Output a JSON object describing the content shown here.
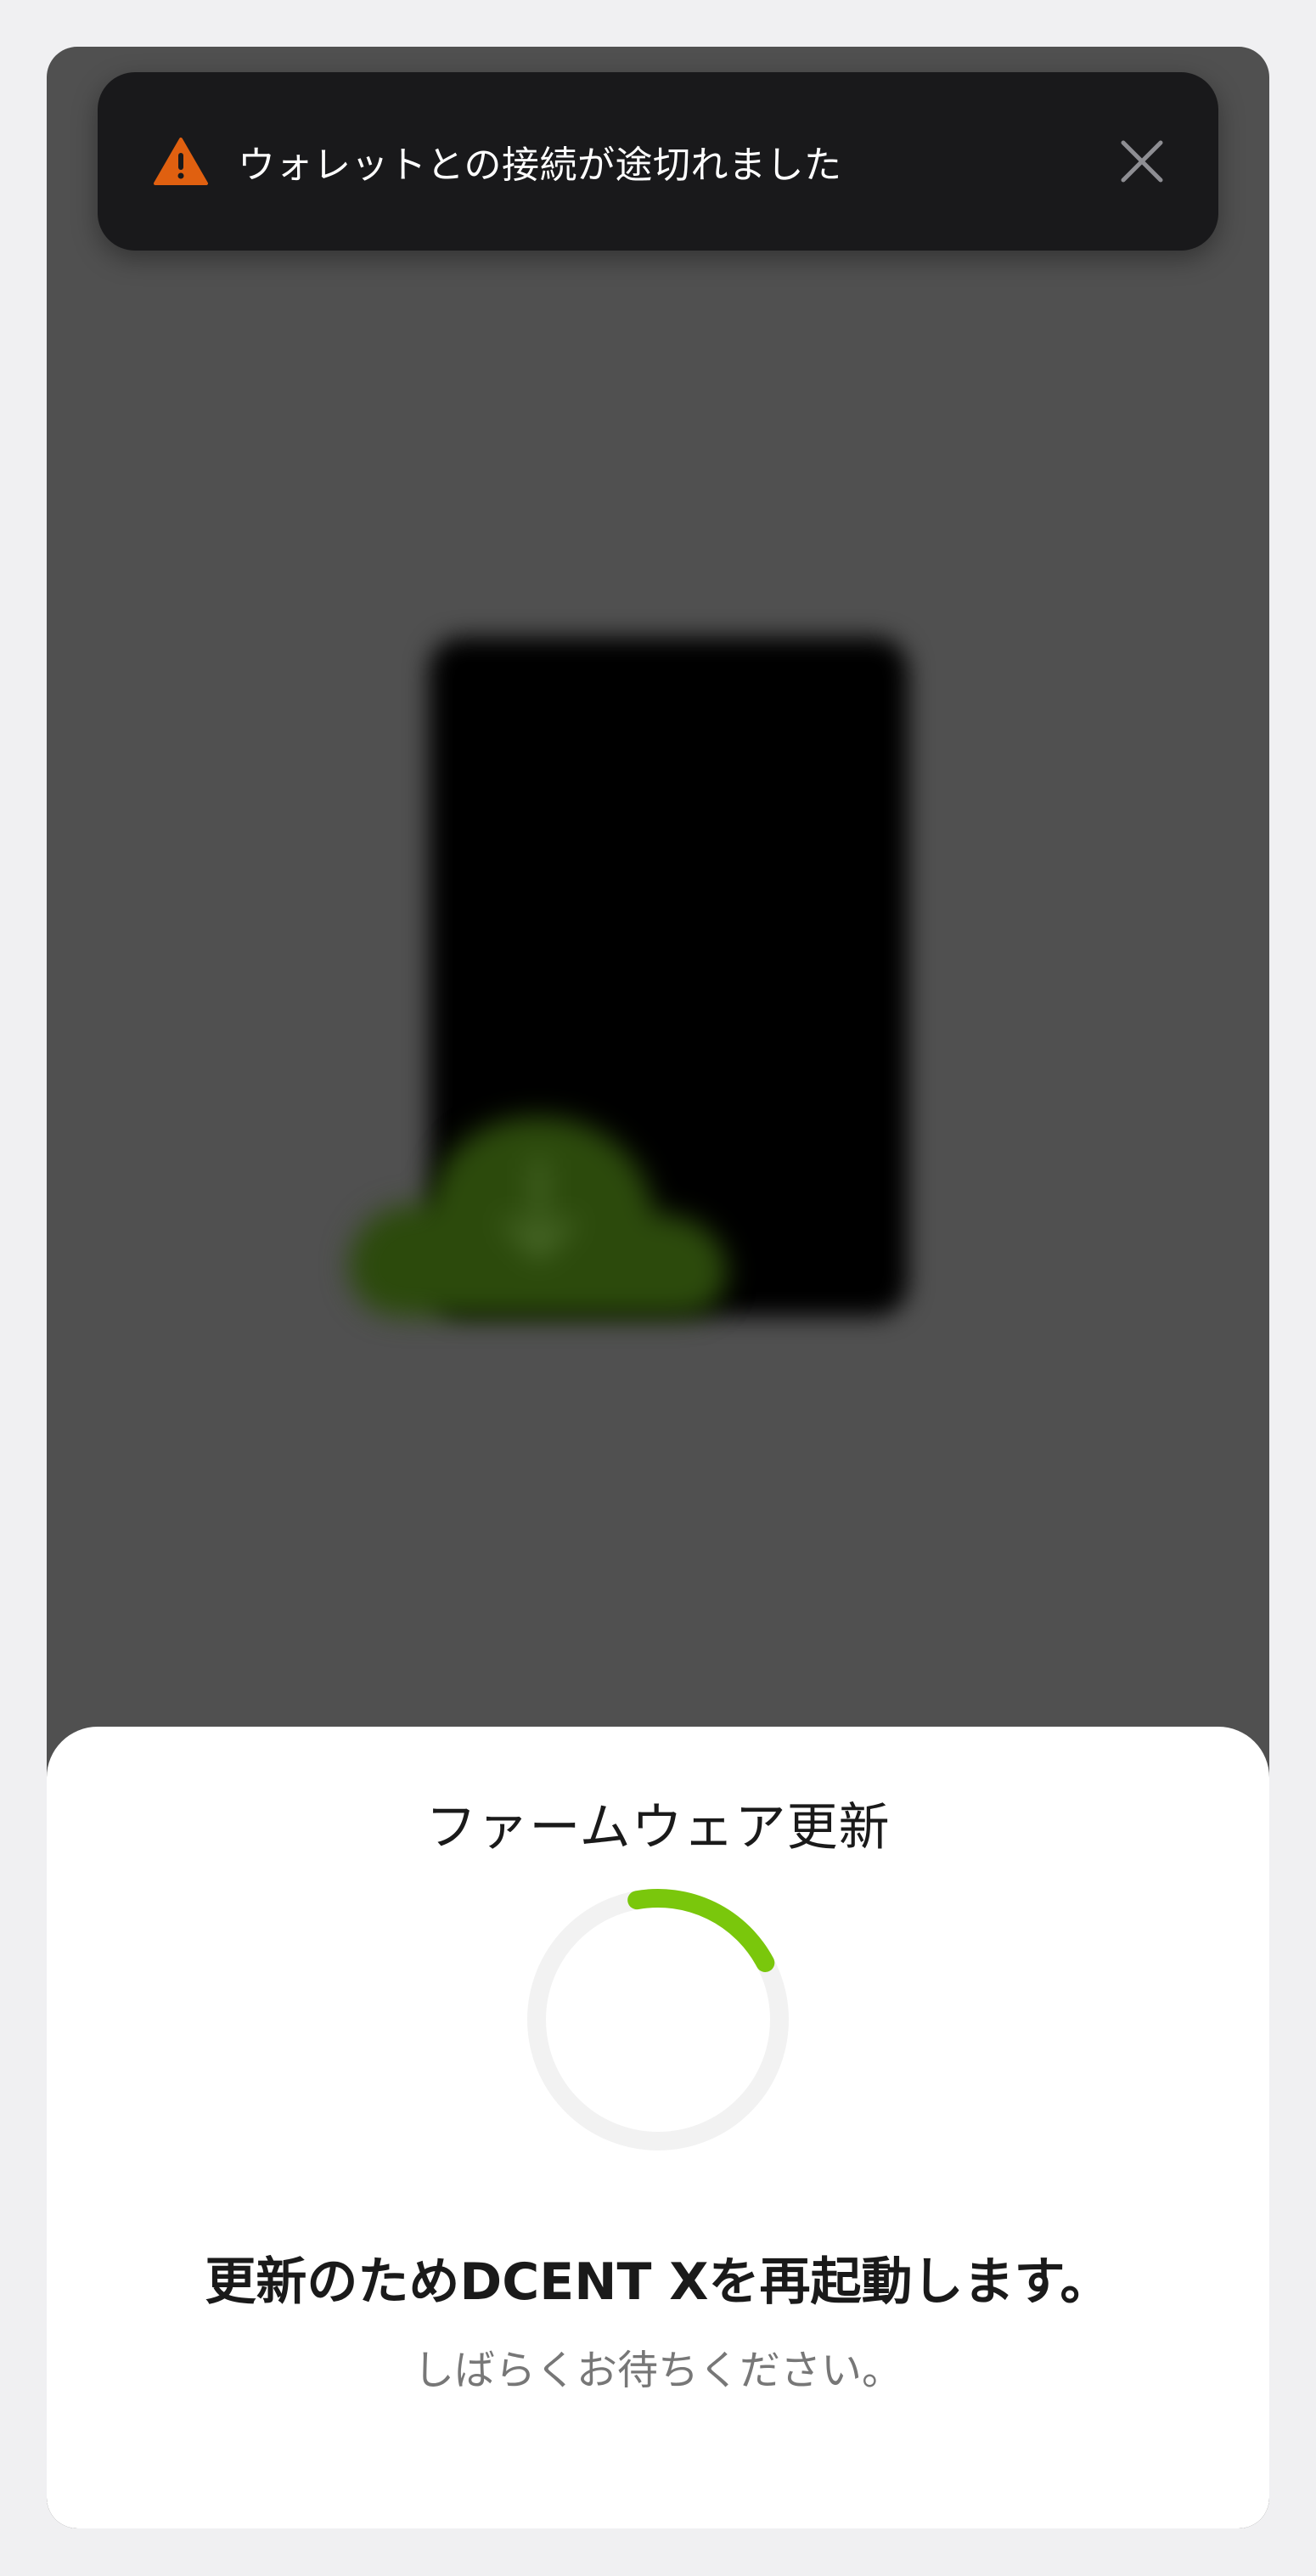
{
  "toast": {
    "message": "ウォレットとの接続が途切れました",
    "warning_color": "#e06010"
  },
  "sheet": {
    "title": "ファームウェア更新",
    "headline": "更新のためDCENT Xを再起動します。",
    "subtext": "しばらくお待ちください。",
    "progress_fraction": 0.2,
    "accent_color": "#7ac70c"
  }
}
